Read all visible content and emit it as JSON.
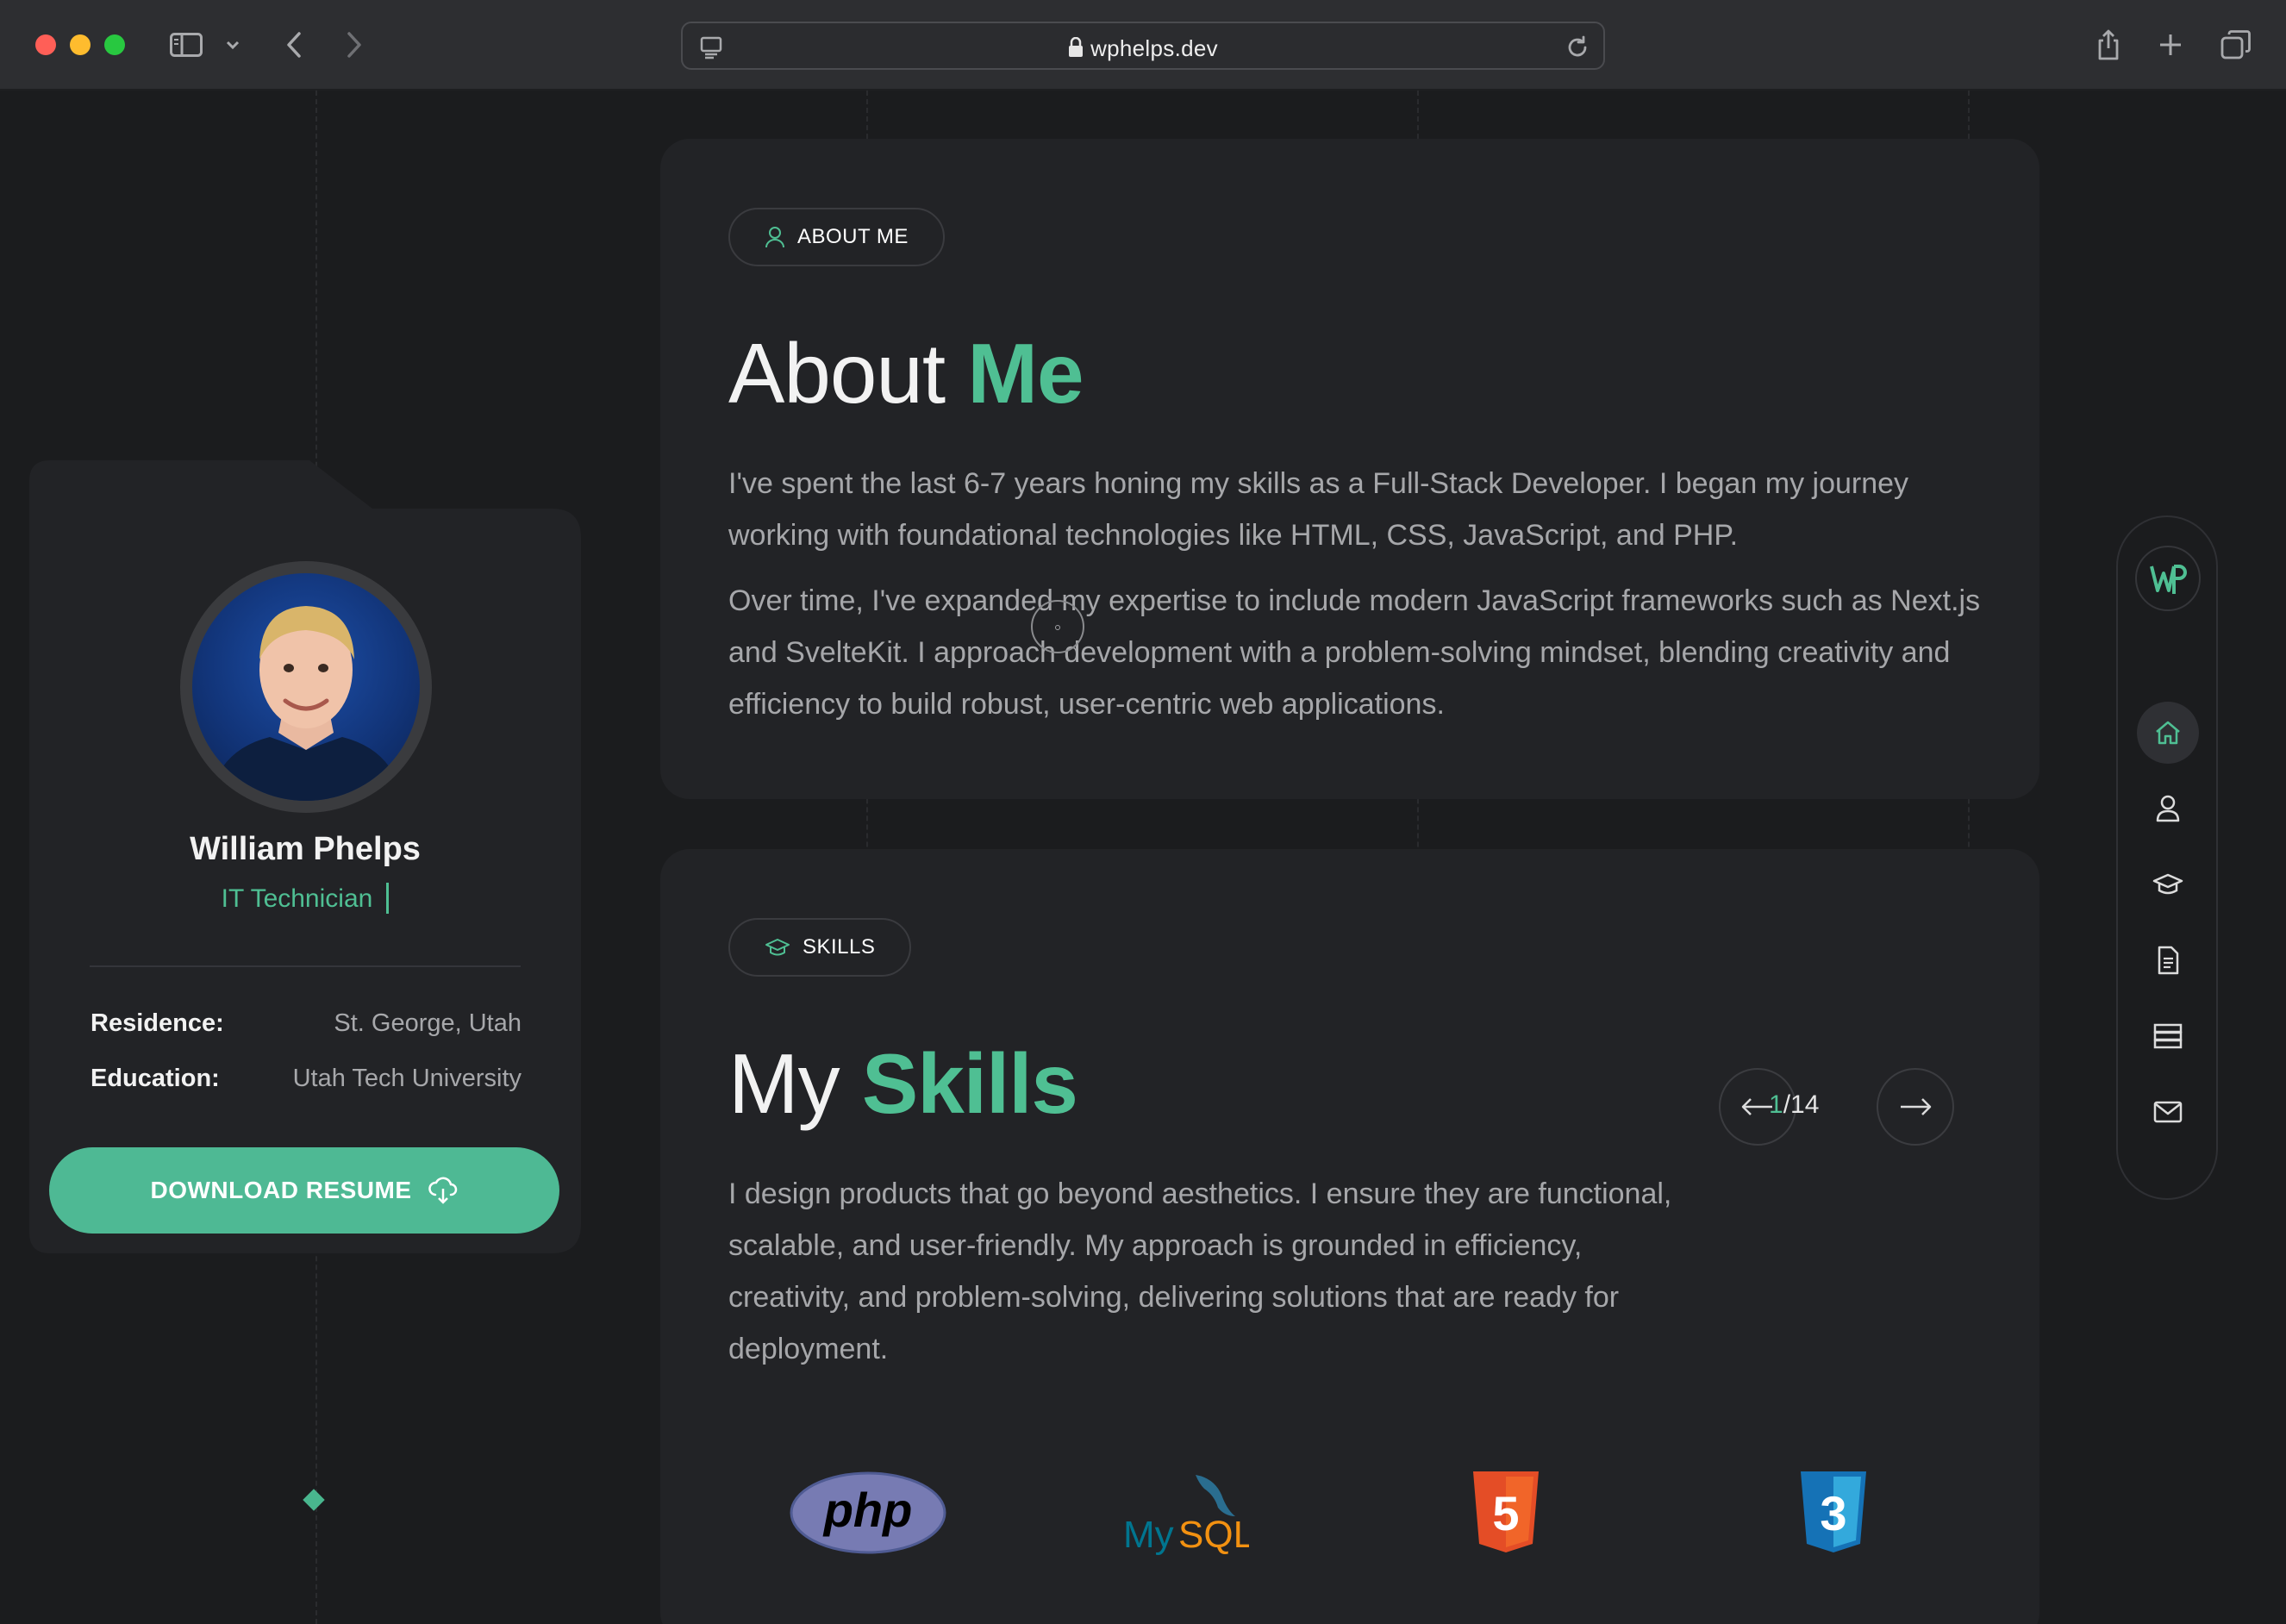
{
  "browser": {
    "url": "wphelps.dev"
  },
  "profile": {
    "name": "William Phelps",
    "role": "IT Technician",
    "details": [
      {
        "key": "Residence:",
        "value": "St. George, Utah"
      },
      {
        "key": "Education:",
        "value": "Utah Tech University"
      }
    ],
    "download_label": "DOWNLOAD RESUME"
  },
  "about": {
    "pill": "ABOUT ME",
    "title_plain": "About ",
    "title_accent": "Me",
    "paragraph_1": "I've spent the last 6-7 years honing my skills as a Full-Stack Developer. I began my journey working with foundational technologies like HTML, CSS, JavaScript, and PHP.",
    "paragraph_2": "Over time, I've expanded my expertise to include modern JavaScript frameworks such as Next.js and SvelteKit. I approach development with a problem-solving mindset, blending creativity and efficiency to build robust, user-centric web applications."
  },
  "skills": {
    "pill": "SKILLS",
    "title_plain": "My ",
    "title_accent": "Skills",
    "counter_current": "1",
    "counter_total": "/14",
    "paragraph": "I design products that go beyond aesthetics. I ensure they are functional, scalable, and user-friendly. My approach is grounded in efficiency, creativity, and problem-solving, delivering solutions that are ready for deployment.",
    "logos": [
      {
        "name": "php",
        "text": "php"
      },
      {
        "name": "mysql",
        "text_a": "My",
        "text_b": "SQL"
      },
      {
        "name": "html5",
        "text": "5"
      },
      {
        "name": "css3",
        "text": "3"
      }
    ]
  },
  "nav": {
    "logo_text": "WP",
    "items": [
      "home-icon",
      "user-icon",
      "graduation-cap-icon",
      "document-icon",
      "server-icon",
      "mail-icon"
    ]
  },
  "colors": {
    "accent": "#4fbf93",
    "background": "#1b1c1e",
    "card": "#222326"
  }
}
